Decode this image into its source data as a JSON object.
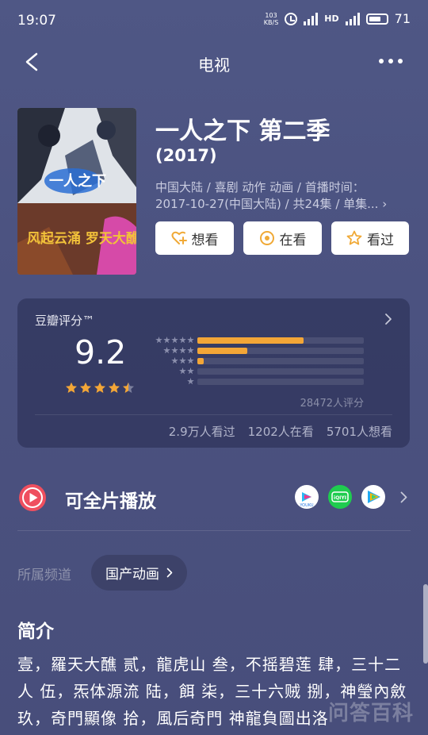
{
  "status_bar": {
    "time": "19:07",
    "net_speed_value": "103",
    "net_speed_unit": "KB/S",
    "network_label": "4G",
    "network2_label": "4G+",
    "hd_label": "HD",
    "battery": "71",
    "battery_level": 0.71
  },
  "nav": {
    "title": "电视"
  },
  "show": {
    "title": "一人之下 第二季",
    "year": "(2017)",
    "meta_line1": "中国大陆 / 喜剧 动作 动画 / 首播时间：",
    "meta_line2": "2017-10-27(中国大陆) / 共24集 / 单集...",
    "poster_text_top": "一人之下",
    "poster_text_bottom": "风起云涌 罗天大醮"
  },
  "actions": [
    {
      "label": "想看",
      "icon": "heart-plus-icon"
    },
    {
      "label": "在看",
      "icon": "target-icon"
    },
    {
      "label": "看过",
      "icon": "star-outline-icon"
    }
  ],
  "rating": {
    "label": "豆瓣评分™",
    "score": "9.2",
    "stars": 4.5,
    "raters": "28472人评分",
    "distribution": [
      {
        "stars": 5,
        "fraction": 0.64
      },
      {
        "stars": 4,
        "fraction": 0.3
      },
      {
        "stars": 3,
        "fraction": 0.04
      },
      {
        "stars": 2,
        "fraction": 0.0
      },
      {
        "stars": 1,
        "fraction": 0.0
      }
    ],
    "seen": "2.9万人看过",
    "watching": "1202人在看",
    "wish": "5701人想看",
    "accent_color": "#f3a637"
  },
  "play": {
    "label": "可全片播放",
    "platforms": [
      {
        "name": "youku-icon",
        "text": "YOUKU"
      },
      {
        "name": "iqiyi-icon",
        "text": "iQIYI"
      },
      {
        "name": "tencent-video-icon",
        "text": ""
      }
    ]
  },
  "channel": {
    "label": "所属频道",
    "value": "国产动画"
  },
  "intro": {
    "title": "简介",
    "text": "壹，羅天大醮 贰，龍虎山 叁，不摇碧莲 肆，三十二人 伍，炁体源流 陆，餌 柒，三十六贼 捌，神瑩內斂 玖，奇門顯像 拾，風后奇門 神龍負圖出洛"
  },
  "watermark": "问答百科"
}
